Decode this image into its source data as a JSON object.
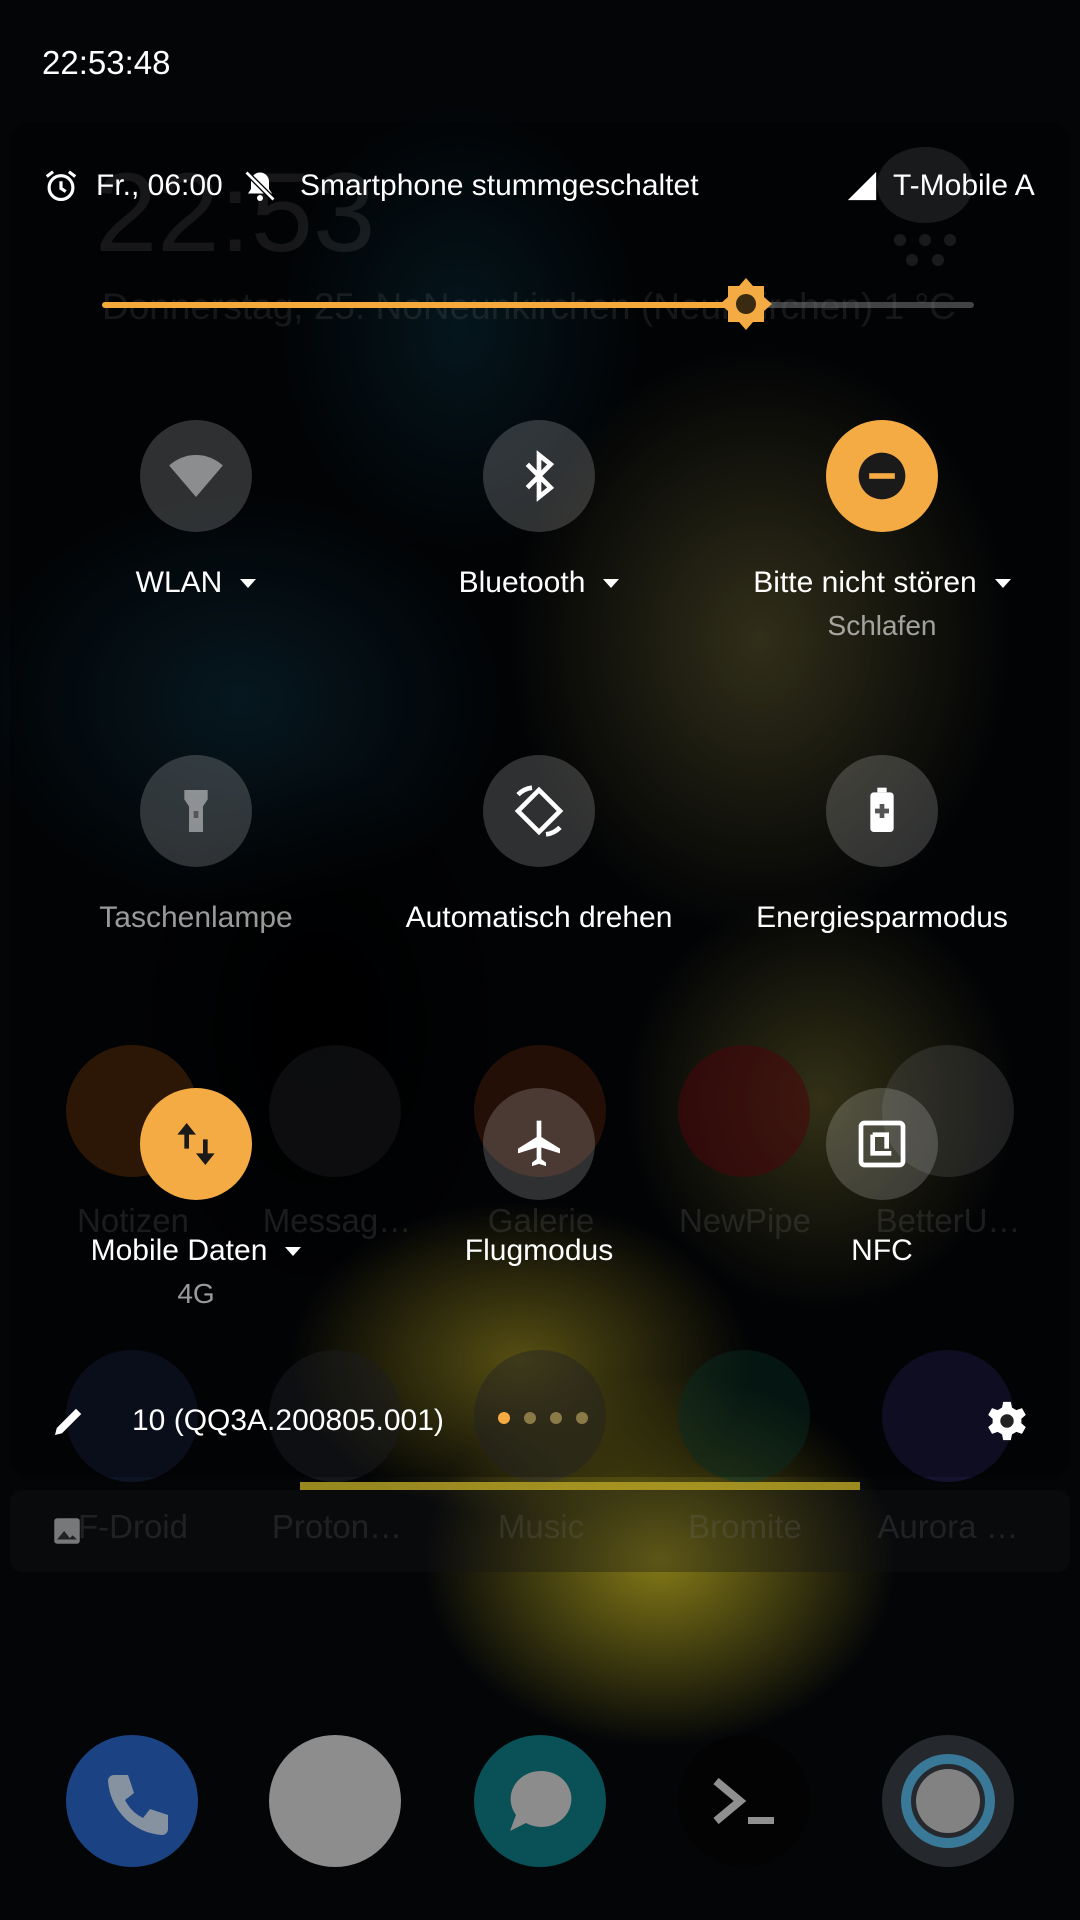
{
  "status_bar": {
    "time": "22:53:48"
  },
  "header": {
    "alarm_text": "Fr., 06:00",
    "ringer_text": "Smartphone stummgeschaltet",
    "carrier": "T-Mobile A"
  },
  "brightness": {
    "level": 0.73
  },
  "tiles": [
    {
      "label": "WLAN",
      "state": "off",
      "dropdown": true,
      "icon": "wifi-icon"
    },
    {
      "label": "Bluetooth",
      "state": "off",
      "dropdown": true,
      "icon": "bluetooth-icon"
    },
    {
      "label": "Bitte nicht stören",
      "sublabel": "Schlafen",
      "state": "on",
      "dropdown": true,
      "icon": "do-not-disturb-icon"
    },
    {
      "label": "Taschenlampe",
      "state": "off",
      "dropdown": false,
      "icon": "flashlight-icon"
    },
    {
      "label": "Automatisch drehen",
      "state": "off",
      "dropdown": false,
      "icon": "auto-rotate-icon"
    },
    {
      "label": "Energiesparmodus",
      "state": "off",
      "dropdown": false,
      "icon": "battery-saver-icon"
    },
    {
      "label": "Mobile Daten",
      "sublabel": "4G",
      "state": "on",
      "dropdown": true,
      "icon": "mobile-data-icon"
    },
    {
      "label": "Flugmodus",
      "state": "off",
      "dropdown": false,
      "icon": "airplane-icon"
    },
    {
      "label": "NFC",
      "state": "off",
      "dropdown": false,
      "icon": "nfc-icon"
    }
  ],
  "footer": {
    "build": "10 (QQ3A.200805.001)"
  },
  "home_screen": {
    "clock": "22:53",
    "date_line": "Donnerstag, 25. NoNeunkirchen (Neunkirchen) 1 °C",
    "apps_row1": [
      "Notizen",
      "Messag…",
      "Galerie",
      "NewPipe",
      "BetterU…"
    ],
    "apps_row2": [
      "F-Droid",
      "Proton…",
      "Music",
      "Bromite",
      "Aurora …"
    ]
  },
  "colors": {
    "accent": "#f5ab43"
  }
}
